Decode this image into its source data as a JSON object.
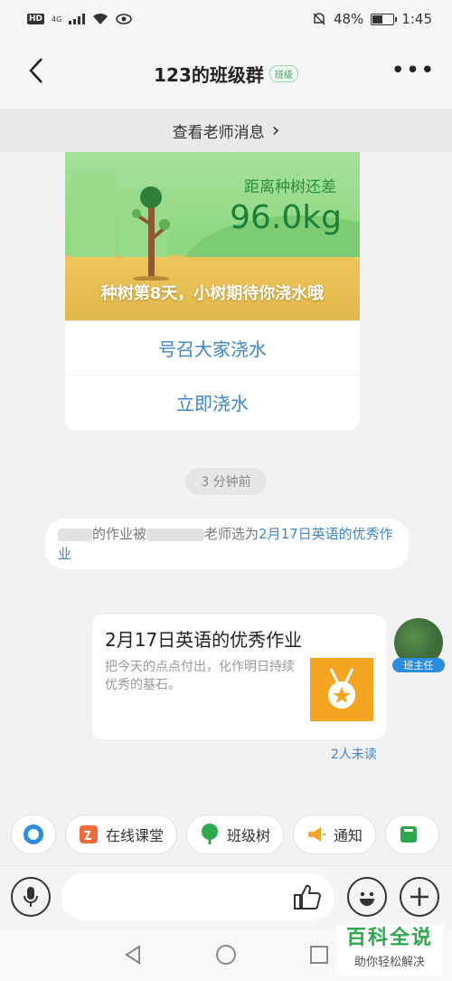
{
  "status_bar": {
    "network": "4G",
    "battery": "48%",
    "time": "1:45"
  },
  "header": {
    "title": "123的班级群",
    "badge": "班级"
  },
  "teacher_notice": {
    "label": "查看老师消息",
    "arrow": "›"
  },
  "tree_card": {
    "distance_label": "距离种树还差",
    "distance_value": "96.0kg",
    "caption": "种树第8天，小树期待你浇水哦",
    "call_button": "号召大家浇水",
    "water_button": "立即浇水"
  },
  "timestamp": "3 分钟前",
  "system_notice": {
    "part1": "的作业被",
    "part2": "老师选为",
    "link": "2月17日英语的优秀作业"
  },
  "homework": {
    "title": "2月17日英语的优秀作业",
    "description": "把今天的点点付出，化作明日持续优秀的基石。",
    "role": "班主任",
    "unread": "2人未读"
  },
  "tools": [
    {
      "label": "在线课堂",
      "icon": "online-class-icon",
      "color": "#f06a3a"
    },
    {
      "label": "班级树",
      "icon": "tree-icon",
      "color": "#2ea84f"
    },
    {
      "label": "通知",
      "icon": "megaphone-icon",
      "color": "#f4a623"
    }
  ],
  "input_bar": {
    "placeholder": ""
  },
  "watermark": {
    "title": "百科全说",
    "subtitle": "助你轻松解决"
  },
  "colors": {
    "link": "#3f86c7",
    "accent_green": "#2ea84f",
    "accent_orange": "#f4a623"
  }
}
